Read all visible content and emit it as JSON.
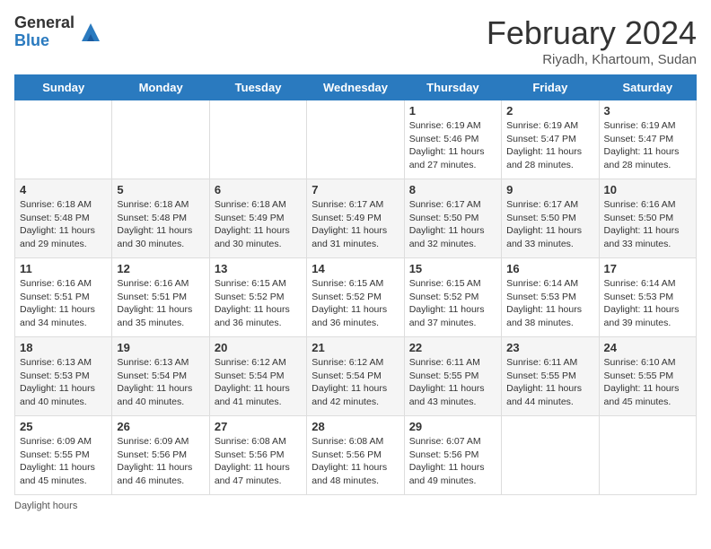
{
  "logo": {
    "general": "General",
    "blue": "Blue"
  },
  "title": "February 2024",
  "location": "Riyadh, Khartoum, Sudan",
  "days_of_week": [
    "Sunday",
    "Monday",
    "Tuesday",
    "Wednesday",
    "Thursday",
    "Friday",
    "Saturday"
  ],
  "weeks": [
    [
      {
        "day": "",
        "info": ""
      },
      {
        "day": "",
        "info": ""
      },
      {
        "day": "",
        "info": ""
      },
      {
        "day": "",
        "info": ""
      },
      {
        "day": "1",
        "sunrise": "Sunrise: 6:19 AM",
        "sunset": "Sunset: 5:46 PM",
        "daylight": "Daylight: 11 hours and 27 minutes."
      },
      {
        "day": "2",
        "sunrise": "Sunrise: 6:19 AM",
        "sunset": "Sunset: 5:47 PM",
        "daylight": "Daylight: 11 hours and 28 minutes."
      },
      {
        "day": "3",
        "sunrise": "Sunrise: 6:19 AM",
        "sunset": "Sunset: 5:47 PM",
        "daylight": "Daylight: 11 hours and 28 minutes."
      }
    ],
    [
      {
        "day": "4",
        "sunrise": "Sunrise: 6:18 AM",
        "sunset": "Sunset: 5:48 PM",
        "daylight": "Daylight: 11 hours and 29 minutes."
      },
      {
        "day": "5",
        "sunrise": "Sunrise: 6:18 AM",
        "sunset": "Sunset: 5:48 PM",
        "daylight": "Daylight: 11 hours and 30 minutes."
      },
      {
        "day": "6",
        "sunrise": "Sunrise: 6:18 AM",
        "sunset": "Sunset: 5:49 PM",
        "daylight": "Daylight: 11 hours and 30 minutes."
      },
      {
        "day": "7",
        "sunrise": "Sunrise: 6:17 AM",
        "sunset": "Sunset: 5:49 PM",
        "daylight": "Daylight: 11 hours and 31 minutes."
      },
      {
        "day": "8",
        "sunrise": "Sunrise: 6:17 AM",
        "sunset": "Sunset: 5:50 PM",
        "daylight": "Daylight: 11 hours and 32 minutes."
      },
      {
        "day": "9",
        "sunrise": "Sunrise: 6:17 AM",
        "sunset": "Sunset: 5:50 PM",
        "daylight": "Daylight: 11 hours and 33 minutes."
      },
      {
        "day": "10",
        "sunrise": "Sunrise: 6:16 AM",
        "sunset": "Sunset: 5:50 PM",
        "daylight": "Daylight: 11 hours and 33 minutes."
      }
    ],
    [
      {
        "day": "11",
        "sunrise": "Sunrise: 6:16 AM",
        "sunset": "Sunset: 5:51 PM",
        "daylight": "Daylight: 11 hours and 34 minutes."
      },
      {
        "day": "12",
        "sunrise": "Sunrise: 6:16 AM",
        "sunset": "Sunset: 5:51 PM",
        "daylight": "Daylight: 11 hours and 35 minutes."
      },
      {
        "day": "13",
        "sunrise": "Sunrise: 6:15 AM",
        "sunset": "Sunset: 5:52 PM",
        "daylight": "Daylight: 11 hours and 36 minutes."
      },
      {
        "day": "14",
        "sunrise": "Sunrise: 6:15 AM",
        "sunset": "Sunset: 5:52 PM",
        "daylight": "Daylight: 11 hours and 36 minutes."
      },
      {
        "day": "15",
        "sunrise": "Sunrise: 6:15 AM",
        "sunset": "Sunset: 5:52 PM",
        "daylight": "Daylight: 11 hours and 37 minutes."
      },
      {
        "day": "16",
        "sunrise": "Sunrise: 6:14 AM",
        "sunset": "Sunset: 5:53 PM",
        "daylight": "Daylight: 11 hours and 38 minutes."
      },
      {
        "day": "17",
        "sunrise": "Sunrise: 6:14 AM",
        "sunset": "Sunset: 5:53 PM",
        "daylight": "Daylight: 11 hours and 39 minutes."
      }
    ],
    [
      {
        "day": "18",
        "sunrise": "Sunrise: 6:13 AM",
        "sunset": "Sunset: 5:53 PM",
        "daylight": "Daylight: 11 hours and 40 minutes."
      },
      {
        "day": "19",
        "sunrise": "Sunrise: 6:13 AM",
        "sunset": "Sunset: 5:54 PM",
        "daylight": "Daylight: 11 hours and 40 minutes."
      },
      {
        "day": "20",
        "sunrise": "Sunrise: 6:12 AM",
        "sunset": "Sunset: 5:54 PM",
        "daylight": "Daylight: 11 hours and 41 minutes."
      },
      {
        "day": "21",
        "sunrise": "Sunrise: 6:12 AM",
        "sunset": "Sunset: 5:54 PM",
        "daylight": "Daylight: 11 hours and 42 minutes."
      },
      {
        "day": "22",
        "sunrise": "Sunrise: 6:11 AM",
        "sunset": "Sunset: 5:55 PM",
        "daylight": "Daylight: 11 hours and 43 minutes."
      },
      {
        "day": "23",
        "sunrise": "Sunrise: 6:11 AM",
        "sunset": "Sunset: 5:55 PM",
        "daylight": "Daylight: 11 hours and 44 minutes."
      },
      {
        "day": "24",
        "sunrise": "Sunrise: 6:10 AM",
        "sunset": "Sunset: 5:55 PM",
        "daylight": "Daylight: 11 hours and 45 minutes."
      }
    ],
    [
      {
        "day": "25",
        "sunrise": "Sunrise: 6:09 AM",
        "sunset": "Sunset: 5:55 PM",
        "daylight": "Daylight: 11 hours and 45 minutes."
      },
      {
        "day": "26",
        "sunrise": "Sunrise: 6:09 AM",
        "sunset": "Sunset: 5:56 PM",
        "daylight": "Daylight: 11 hours and 46 minutes."
      },
      {
        "day": "27",
        "sunrise": "Sunrise: 6:08 AM",
        "sunset": "Sunset: 5:56 PM",
        "daylight": "Daylight: 11 hours and 47 minutes."
      },
      {
        "day": "28",
        "sunrise": "Sunrise: 6:08 AM",
        "sunset": "Sunset: 5:56 PM",
        "daylight": "Daylight: 11 hours and 48 minutes."
      },
      {
        "day": "29",
        "sunrise": "Sunrise: 6:07 AM",
        "sunset": "Sunset: 5:56 PM",
        "daylight": "Daylight: 11 hours and 49 minutes."
      },
      {
        "day": "",
        "info": ""
      },
      {
        "day": "",
        "info": ""
      }
    ]
  ],
  "footer": {
    "daylight_hours": "Daylight hours"
  }
}
